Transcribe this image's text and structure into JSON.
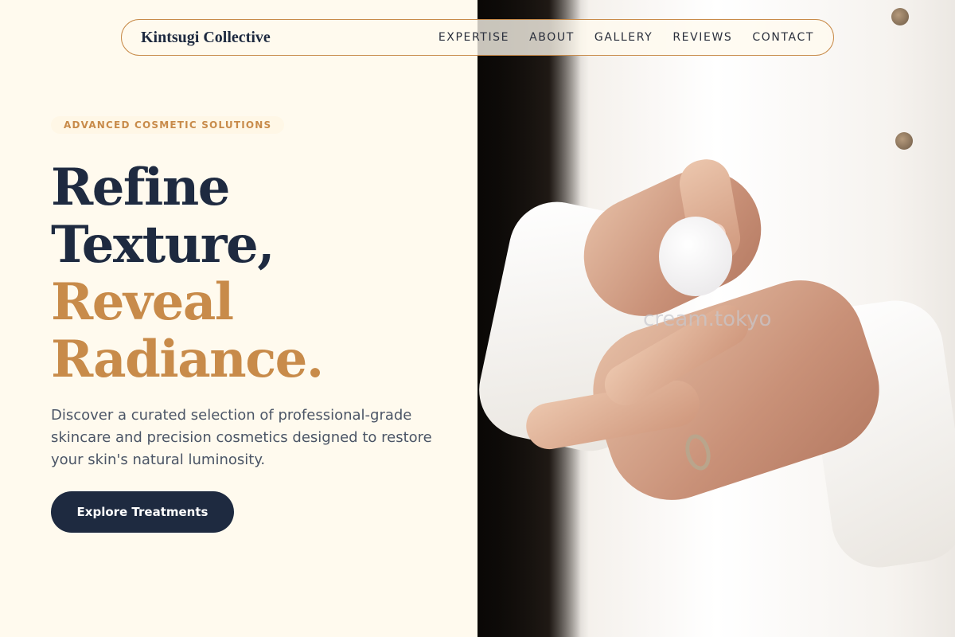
{
  "brand": {
    "name": "Kintsugi Collective"
  },
  "nav": {
    "items": [
      {
        "label": "EXPERTISE"
      },
      {
        "label": "ABOUT"
      },
      {
        "label": "GALLERY"
      },
      {
        "label": "REVIEWS"
      },
      {
        "label": "CONTACT"
      }
    ]
  },
  "hero": {
    "eyebrow": "ADVANCED COSMETIC SOLUTIONS",
    "headline_line1": "Refine",
    "headline_line2": "Texture,",
    "headline_line3": "Reveal",
    "headline_line4": "Radiance.",
    "description": "Discover a curated selection of professional-grade skincare and precision cosmetics designed to restore your skin's natural luminosity.",
    "cta_label": "Explore Treatments"
  },
  "image": {
    "icon": "photo-hands-applying-cream",
    "watermark": "cream.tokyo"
  },
  "colors": {
    "background": "#fffaee",
    "navy": "#1e2a40",
    "gold": "#c88b4a",
    "body_text": "#4b5566"
  }
}
